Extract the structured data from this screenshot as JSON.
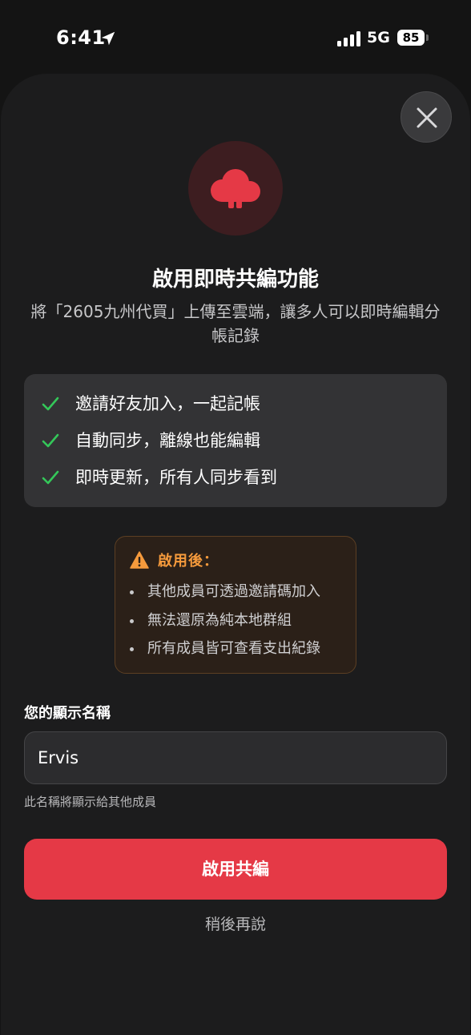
{
  "status_bar": {
    "time": "6:41",
    "location_icon": "location-arrow-icon",
    "signal_icon": "cellular-signal-icon",
    "network": "5G",
    "battery_level": "85"
  },
  "dialog": {
    "close_icon": "close-icon",
    "hero_icon": "cloud-icon",
    "title": "啟用即時共編功能",
    "subtitle": "將「2605九州代買」上傳至雲端，讓多人可以即時編輯分帳記錄",
    "features": [
      {
        "icon": "checkmark-icon",
        "label": "邀請好友加入，一起記帳"
      },
      {
        "icon": "checkmark-icon",
        "label": "自動同步，離線也能編輯"
      },
      {
        "icon": "checkmark-icon",
        "label": "即時更新，所有人同步看到"
      }
    ],
    "warning": {
      "icon": "warning-triangle-icon",
      "title": "啟用後：",
      "items": [
        "其他成員可透過邀請碼加入",
        "無法還原為純本地群組",
        "所有成員皆可查看支出紀錄"
      ]
    },
    "display_name": {
      "label": "您的顯示名稱",
      "value": "Ervis",
      "hint": "此名稱將顯示給其他成員"
    },
    "primary_button": "啟用共編",
    "secondary_link": "稍後再說"
  },
  "colors": {
    "accent_red": "#e53946",
    "check_green": "#34c759",
    "warning_orange": "#f59a3c",
    "sheet_background": "#1c1c1d"
  }
}
